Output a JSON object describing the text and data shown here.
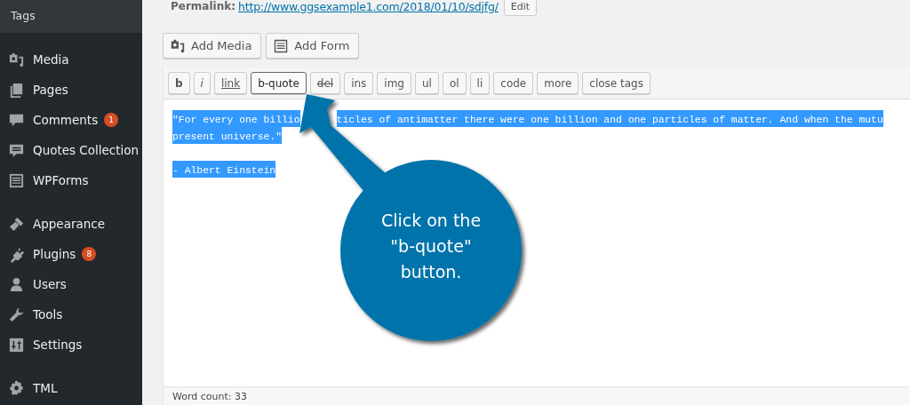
{
  "sidebar": {
    "submenu": [
      {
        "label": "Tags"
      }
    ],
    "groups": [
      [
        {
          "label": "Media",
          "kind": "media"
        },
        {
          "label": "Pages",
          "kind": "pages"
        },
        {
          "label": "Comments",
          "kind": "comments",
          "badge": "1"
        },
        {
          "label": "Quotes Collection",
          "kind": "quotes"
        },
        {
          "label": "WPForms",
          "kind": "forms"
        }
      ],
      [
        {
          "label": "Appearance",
          "kind": "brush"
        },
        {
          "label": "Plugins",
          "kind": "plug",
          "badge": "8"
        },
        {
          "label": "Users",
          "kind": "user"
        },
        {
          "label": "Tools",
          "kind": "wrench"
        },
        {
          "label": "Settings",
          "kind": "settings"
        }
      ],
      [
        {
          "label": "TML",
          "kind": "gear"
        }
      ]
    ]
  },
  "permalink": {
    "label": "Permalink:",
    "url": "http://www.ggsexample1.com/2018/01/10/sdjfg/",
    "edit": "Edit"
  },
  "media_buttons": [
    {
      "label": "Add Media",
      "kind": "media"
    },
    {
      "label": "Add Form",
      "kind": "form"
    }
  ],
  "quicktags": [
    {
      "label": "b",
      "kind": "bold",
      "focused": false
    },
    {
      "label": "i",
      "kind": "italic",
      "focused": false
    },
    {
      "label": "link",
      "kind": "underline",
      "focused": false
    },
    {
      "label": "b-quote",
      "kind": "plain",
      "focused": true
    },
    {
      "label": "del",
      "kind": "strike",
      "focused": false
    },
    {
      "label": "ins",
      "kind": "plain",
      "focused": false
    },
    {
      "label": "img",
      "kind": "plain",
      "focused": false
    },
    {
      "label": "ul",
      "kind": "plain",
      "focused": false
    },
    {
      "label": "ol",
      "kind": "plain",
      "focused": false
    },
    {
      "label": "li",
      "kind": "plain",
      "focused": false
    },
    {
      "label": "code",
      "kind": "plain",
      "focused": false
    },
    {
      "label": "more",
      "kind": "plain",
      "focused": false
    },
    {
      "label": "close tags",
      "kind": "plain",
      "focused": false
    }
  ],
  "editor": {
    "paragraphs": [
      [
        [
          "\"For every one billio",
          "ticles of antimatter there were one billion and one particles of matter. And when the mutu"
        ],
        [
          "present universe.\""
        ]
      ],
      [
        [
          "- Albert Einstein"
        ]
      ]
    ],
    "word_count": "Word count: 33"
  },
  "callout": {
    "text": "Click on the \"b-quote\" button."
  }
}
